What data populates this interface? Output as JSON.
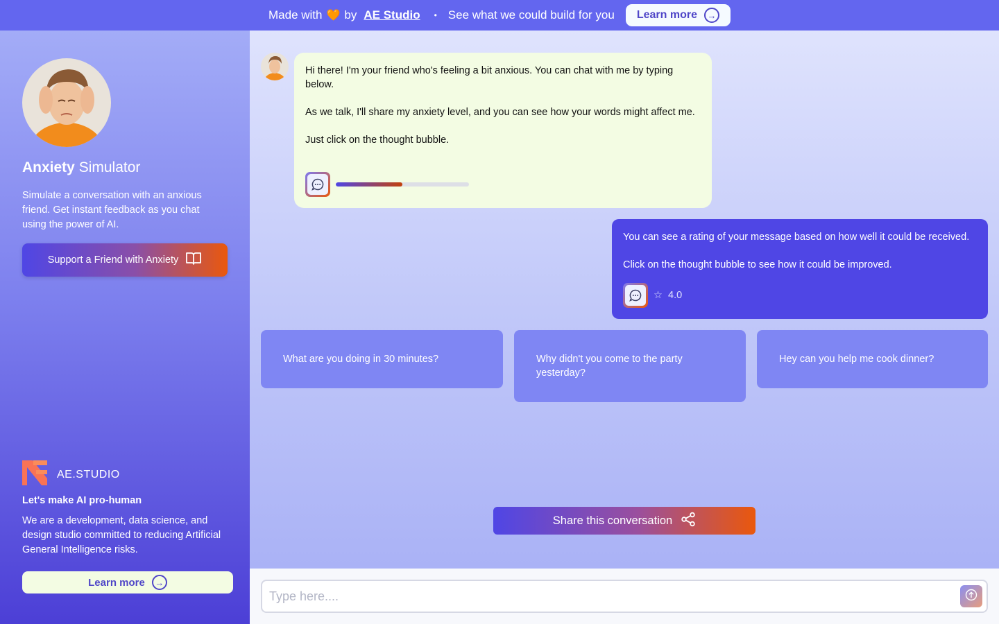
{
  "banner": {
    "made_with": "Made with",
    "heart": "🧡",
    "by": "by",
    "brand": "AE Studio",
    "separator": "•",
    "pitch": "See what we could build for you",
    "learn_more": "Learn more"
  },
  "sidebar": {
    "title_bold": "Anxiety",
    "title_light": "Simulator",
    "description": "Simulate a conversation with an anxious friend. Get instant feedback as you chat using the power of AI.",
    "support_button": "Support a Friend with Anxiety",
    "logo_text": "AE.STUDIO",
    "tagline": "Let's make AI pro-human",
    "about": "We are a development, data science, and design studio committed to reducing Artificial General Intelligence risks.",
    "learn_more": "Learn more"
  },
  "chat": {
    "bot_message": {
      "line1": "Hi there! I'm your friend who's feeling a bit anxious. You can chat with me by typing below.",
      "line2": "As we talk, I'll share my anxiety level, and you can see how your words might affect me.",
      "line3": "Just click on the thought bubble.",
      "anxiety_level": 0.5
    },
    "user_message": {
      "line1": "You can see a rating of your message based on how well it could be received.",
      "line2": "Click on the thought bubble to see how it could be improved.",
      "rating": "4.0"
    },
    "suggestions": [
      "What are you doing in 30 minutes?",
      "Why didn't you come to the party yesterday?",
      "Hey can you help me cook dinner?"
    ],
    "share_button": "Share this conversation"
  },
  "composer": {
    "placeholder": "Type here...."
  },
  "colors": {
    "accent": "#4f46e5",
    "banner": "#6366ef",
    "orange": "#ea580c",
    "bot_bubble": "#f3fce3",
    "suggestion": "#7f86f3"
  }
}
